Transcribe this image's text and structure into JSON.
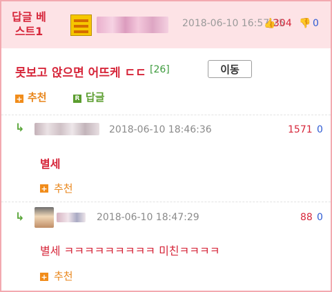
{
  "header": {
    "best_label": "답글 베스트1",
    "date": "2018-06-10 16:57:25",
    "upvotes": "304",
    "downvotes": "0"
  },
  "post": {
    "title": "못보고 앉으면 어뜨케 ㄷㄷ",
    "reply_count": "[26]",
    "move_label": "이동",
    "recommend_label": "추천",
    "reply_label": "답글"
  },
  "comments": [
    {
      "date": "2018-06-10 18:46:36",
      "upvotes": "1571",
      "downvotes": "0",
      "text": "별세",
      "recommend_label": "추천"
    },
    {
      "date": "2018-06-10 18:47:29",
      "upvotes": "88",
      "downvotes": "0",
      "text": "별세 ㅋㅋㅋㅋㅋㅋㅋㅋㅋ 미친ㅋㅋㅋㅋ",
      "recommend_label": "추천"
    }
  ],
  "icons": {
    "plus": "+",
    "reply_square": "R",
    "reply_arrow": "↳",
    "thumbs_up": "👍",
    "thumbs_down": "👎"
  },
  "colors": {
    "accent_red": "#d6263a",
    "accent_orange": "#e8861b",
    "accent_green": "#5b9d2f",
    "downvote_blue": "#2f5bd3",
    "header_bg": "#fde3e6",
    "border_pink": "#f3a9b0"
  }
}
